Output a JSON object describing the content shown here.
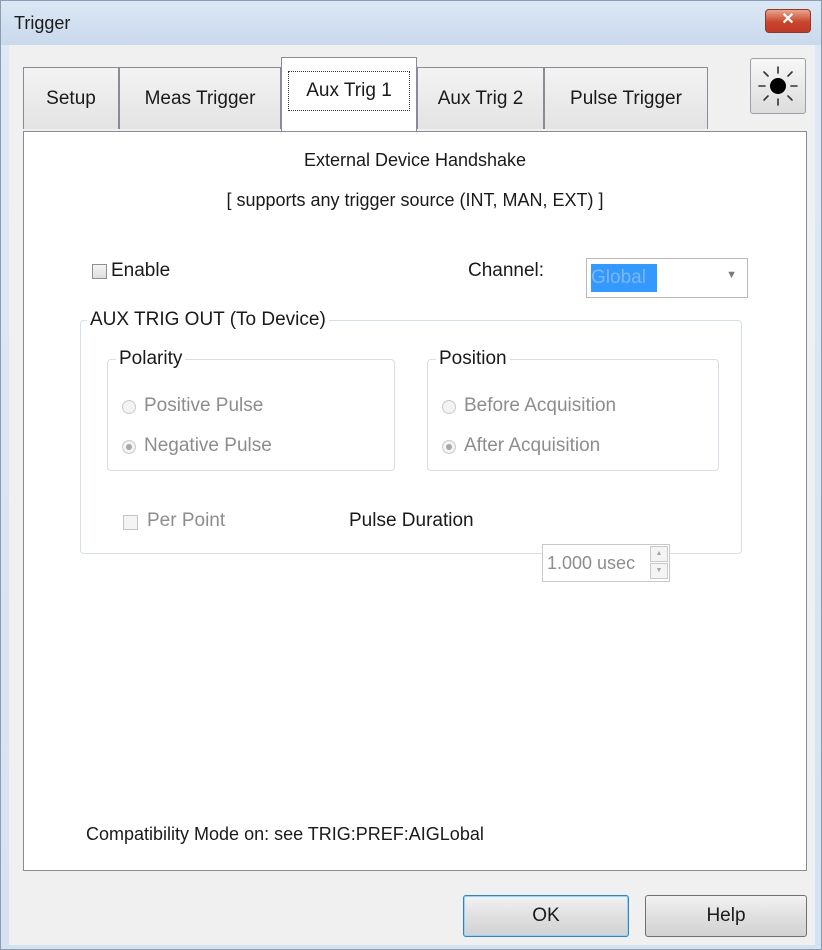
{
  "window": {
    "title": "Trigger",
    "close_glyph": "✕"
  },
  "tabs": [
    {
      "label": "Setup",
      "active": false
    },
    {
      "label": "Meas Trigger",
      "active": false
    },
    {
      "label": "Aux Trig 1",
      "active": true
    },
    {
      "label": "Aux Trig 2",
      "active": false
    },
    {
      "label": "Pulse Trigger",
      "active": false
    }
  ],
  "toolbar": {
    "sun_icon": "sun-icon"
  },
  "panel": {
    "heading": "External Device Handshake",
    "subheading": "[ supports any trigger source (INT, MAN, EXT) ]",
    "enable_label": "Enable",
    "enable_checked": false,
    "channel_label": "Channel:",
    "channel_value": "Global",
    "aux_group_title": "AUX TRIG OUT (To Device)",
    "polarity": {
      "title": "Polarity",
      "options": [
        "Positive Pulse",
        "Negative Pulse"
      ],
      "selected": "Negative Pulse"
    },
    "position": {
      "title": "Position",
      "options": [
        "Before Acquisition",
        "After Acquisition"
      ],
      "selected": "After Acquisition"
    },
    "per_point_label": "Per Point",
    "pulse_duration_label": "Pulse Duration",
    "pulse_duration_value": "1.000 usec",
    "footer_note": "Compatibility Mode on: see TRIG:PREF:AIGLobal"
  },
  "buttons": {
    "ok": "OK",
    "help": "Help"
  },
  "colors": {
    "selection": "#3399ff",
    "window_frame": "#dbe7f4",
    "close_red": "#c8452b"
  }
}
